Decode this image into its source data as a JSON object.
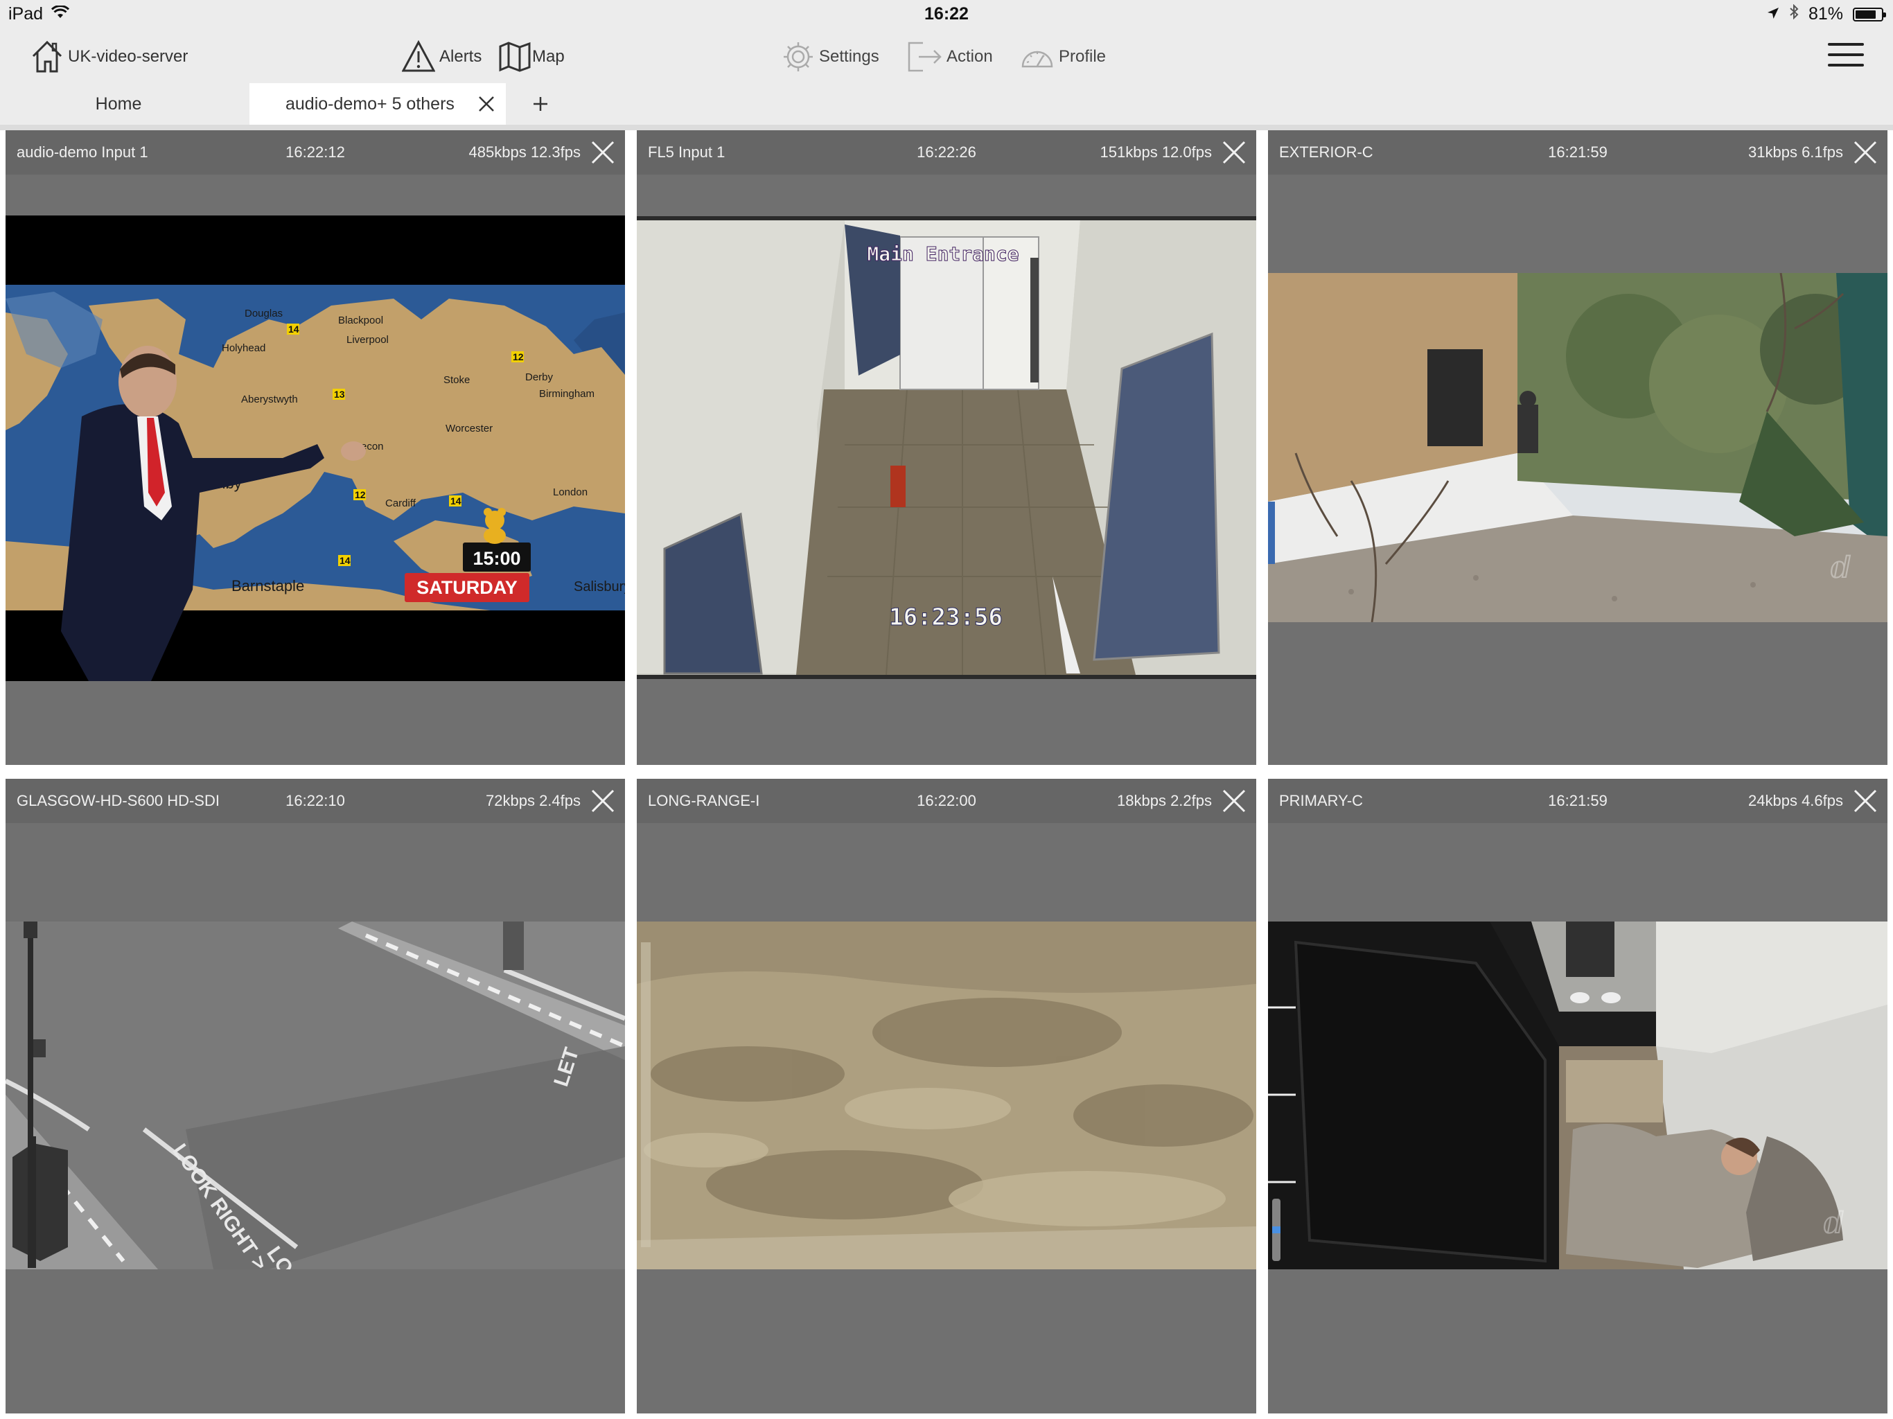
{
  "status_bar": {
    "device": "iPad",
    "time": "16:22",
    "battery_text": "81%",
    "battery_level": 0.81
  },
  "toolbar": {
    "server_label": "UK-video-server",
    "alerts_label": "Alerts",
    "map_label": "Map",
    "settings_label": "Settings",
    "action_label": "Action",
    "profile_label": "Profile"
  },
  "tabs": [
    {
      "label": "Home",
      "active": false
    },
    {
      "label": "audio-demo+ 5 others",
      "active": true
    }
  ],
  "tiles": [
    {
      "name": "audio-demo  Input 1",
      "time": "16:22:12",
      "rate": "485kbps 12.3fps",
      "overlay": {
        "badge_time": "15:00",
        "badge_day": "SATURDAY",
        "places": [
          "Douglas",
          "Blackpool",
          "Liverpool",
          "Holyhead",
          "Aberystwyth",
          "Worcester",
          "Brecon",
          "Cardiff",
          "Barnstaple",
          "Derby",
          "Birmingham",
          "Stoke",
          "Tenby",
          "London",
          "Salisbury"
        ],
        "temps": [
          "14",
          "13",
          "12",
          "14",
          "12",
          "14"
        ]
      }
    },
    {
      "name": "FL5  Input 1",
      "time": "16:22:26",
      "rate": "151kbps 12.0fps",
      "overlay": {
        "sign": "Main Entrance",
        "timestamp": "16:23:56"
      }
    },
    {
      "name": "EXTERIOR-C",
      "time": "16:21:59",
      "rate": "31kbps 6.1fps"
    },
    {
      "name": "GLASGOW-HD-S600  HD-SDI",
      "time": "16:22:10",
      "rate": "72kbps 2.4fps",
      "overlay": {
        "road_text_1": "LOOK RIGHT >",
        "road_text_2": "LOOK",
        "road_text_3": "LET"
      }
    },
    {
      "name": "LONG-RANGE-I",
      "time": "16:22:00",
      "rate": "18kbps 2.2fps"
    },
    {
      "name": "PRIMARY-C",
      "time": "16:21:59",
      "rate": "24kbps 4.6fps"
    }
  ]
}
